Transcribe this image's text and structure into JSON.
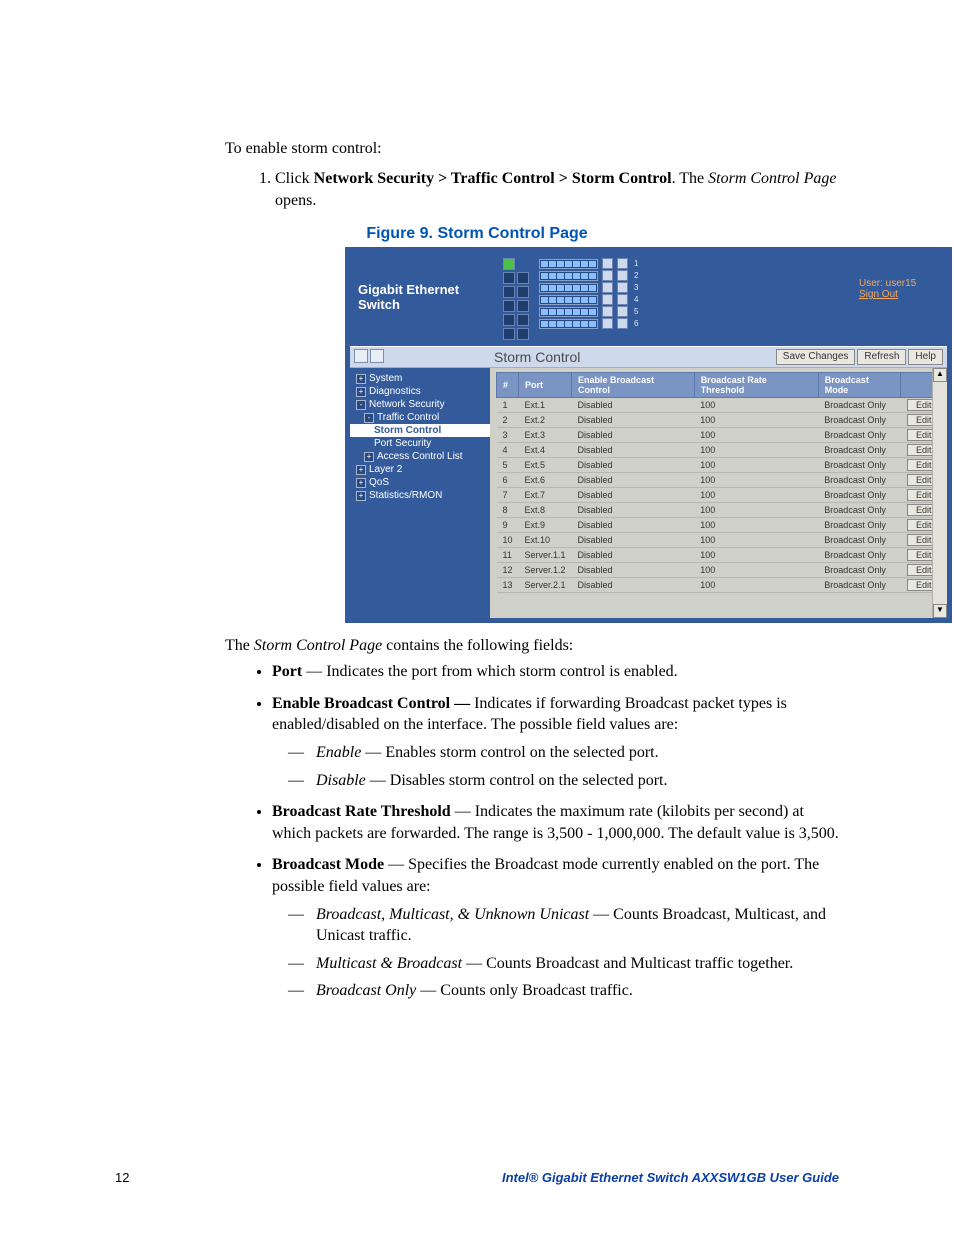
{
  "intro_text": "To enable storm control:",
  "step1_prefix": "Click ",
  "step1_path": "Network Security > Traffic Control > Storm Control",
  "step1_mid": ". The ",
  "step1_pagename": "Storm Control Page",
  "step1_suffix": " opens.",
  "figure_caption": "Figure 9. Storm Control Page",
  "screenshot": {
    "product_title": "Gigabit Ethernet Switch",
    "user_label": "User: user15",
    "signout_label": "Sign Out",
    "page_heading": "Storm Control",
    "buttons": {
      "save": "Save Changes",
      "refresh": "Refresh",
      "help": "Help",
      "edit": "Edit"
    },
    "tree": {
      "system": "System",
      "diagnostics": "Diagnostics",
      "network_security": "Network Security",
      "traffic_control": "Traffic Control",
      "storm_control": "Storm Control",
      "port_security": "Port Security",
      "access_control": "Access Control List",
      "layer2": "Layer 2",
      "qos": "QoS",
      "statistics": "Statistics/RMON"
    },
    "columns": {
      "num": "#",
      "port": "Port",
      "ebc": "Enable Broadcast Control",
      "brt": "Broadcast Rate Threshold",
      "mode": "Broadcast Mode"
    },
    "rows": [
      {
        "n": "1",
        "port": "Ext.1",
        "ebc": "Disabled",
        "brt": "100",
        "mode": "Broadcast Only"
      },
      {
        "n": "2",
        "port": "Ext.2",
        "ebc": "Disabled",
        "brt": "100",
        "mode": "Broadcast Only"
      },
      {
        "n": "3",
        "port": "Ext.3",
        "ebc": "Disabled",
        "brt": "100",
        "mode": "Broadcast Only"
      },
      {
        "n": "4",
        "port": "Ext.4",
        "ebc": "Disabled",
        "brt": "100",
        "mode": "Broadcast Only"
      },
      {
        "n": "5",
        "port": "Ext.5",
        "ebc": "Disabled",
        "brt": "100",
        "mode": "Broadcast Only"
      },
      {
        "n": "6",
        "port": "Ext.6",
        "ebc": "Disabled",
        "brt": "100",
        "mode": "Broadcast Only"
      },
      {
        "n": "7",
        "port": "Ext.7",
        "ebc": "Disabled",
        "brt": "100",
        "mode": "Broadcast Only"
      },
      {
        "n": "8",
        "port": "Ext.8",
        "ebc": "Disabled",
        "brt": "100",
        "mode": "Broadcast Only"
      },
      {
        "n": "9",
        "port": "Ext.9",
        "ebc": "Disabled",
        "brt": "100",
        "mode": "Broadcast Only"
      },
      {
        "n": "10",
        "port": "Ext.10",
        "ebc": "Disabled",
        "brt": "100",
        "mode": "Broadcast Only"
      },
      {
        "n": "11",
        "port": "Server.1.1",
        "ebc": "Disabled",
        "brt": "100",
        "mode": "Broadcast Only"
      },
      {
        "n": "12",
        "port": "Server.1.2",
        "ebc": "Disabled",
        "brt": "100",
        "mode": "Broadcast Only"
      },
      {
        "n": "13",
        "port": "Server.2.1",
        "ebc": "Disabled",
        "brt": "100",
        "mode": "Broadcast Only"
      }
    ]
  },
  "after_figure_prefix": "The ",
  "after_figure_pagename": "Storm Control Page",
  "after_figure_suffix": " contains the following fields:",
  "fields": {
    "port": {
      "term": "Port",
      "desc": " — Indicates the port from which storm control is enabled."
    },
    "ebc": {
      "term": "Enable Broadcast Control — ",
      "desc": "Indicates if forwarding Broadcast packet types is enabled/disabled on the interface. The possible field values are:",
      "sub": {
        "enable": {
          "term": "Enable",
          "desc": " — Enables storm control on the selected port."
        },
        "disable": {
          "term": "Disable",
          "desc": " — Disables storm control on the selected port."
        }
      }
    },
    "brt": {
      "term": "Broadcast Rate Threshold",
      "desc": " — Indicates the maximum rate (kilobits per second) at which packets are forwarded. The range is 3,500 - 1,000,000. The default value is 3,500."
    },
    "bmode": {
      "term": "Broadcast Mode",
      "desc": " — Specifies the Broadcast mode currently enabled on the port. The possible field values are:",
      "sub": {
        "bmu": {
          "term": "Broadcast, Multicast, & Unknown Unicast",
          "desc": " — Counts Broadcast, Multicast, and Unicast traffic."
        },
        "mb": {
          "term": "Multicast & Broadcast",
          "desc": " — Counts Broadcast and Multicast traffic together."
        },
        "bo": {
          "term": "Broadcast Only",
          "desc": " — Counts only Broadcast traffic."
        }
      }
    }
  },
  "footer": {
    "page": "12",
    "title": "Intel® Gigabit Ethernet Switch AXXSW1GB User Guide"
  }
}
